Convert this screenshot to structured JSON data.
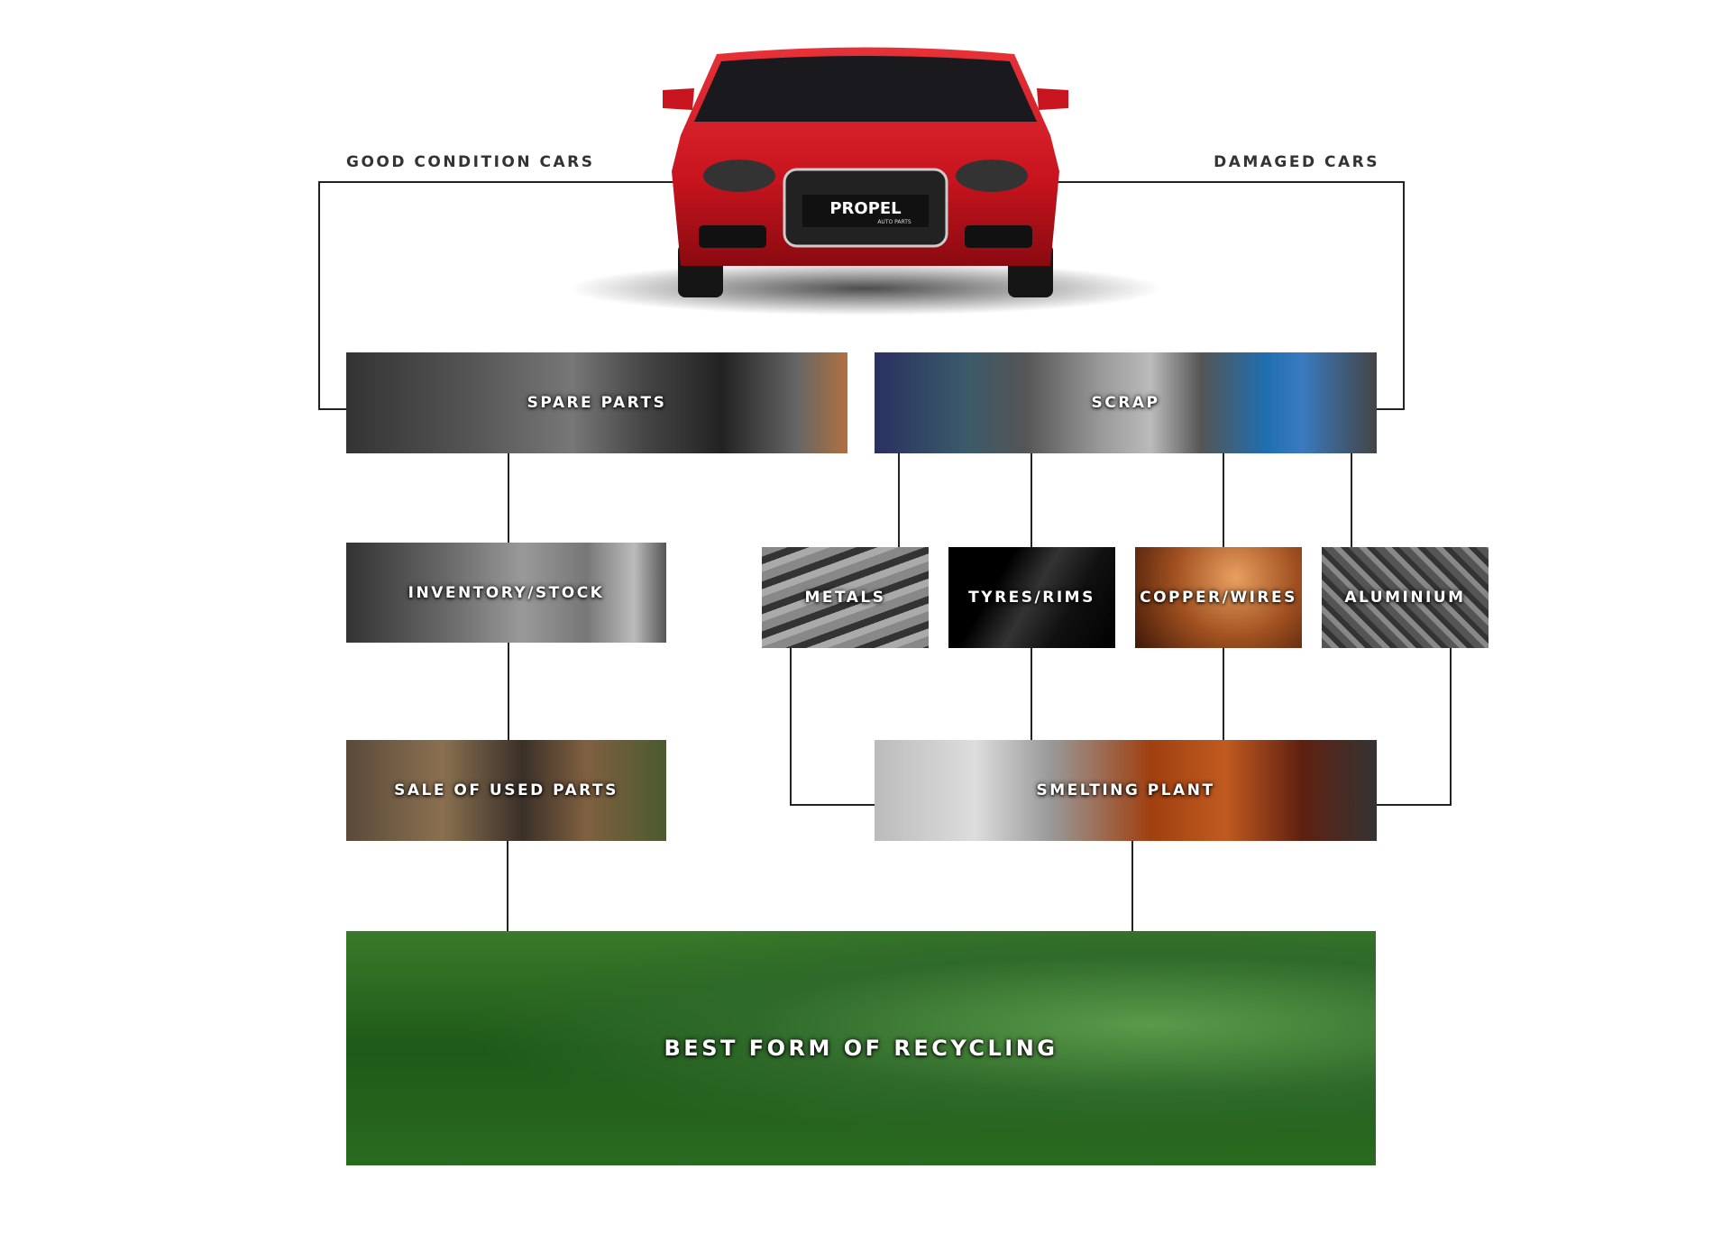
{
  "labels": {
    "good": "GOOD CONDITION CARS",
    "damaged": "DAMAGED CARS"
  },
  "car": {
    "brand": "PROPEL",
    "sub": "AUTO PARTS",
    "color": "#d8202a"
  },
  "nodes": {
    "spare_parts": "SPARE PARTS",
    "scrap": "SCRAP",
    "inventory": "INVENTORY/STOCK",
    "metals": "METALS",
    "tyres": "TYRES/RIMS",
    "copper": "COPPER/WIRES",
    "aluminium": "ALUMINIUM",
    "sale": "SALE OF USED PARTS",
    "smelting": "SMELTING PLANT",
    "recycling": "BEST FORM OF RECYCLING"
  }
}
